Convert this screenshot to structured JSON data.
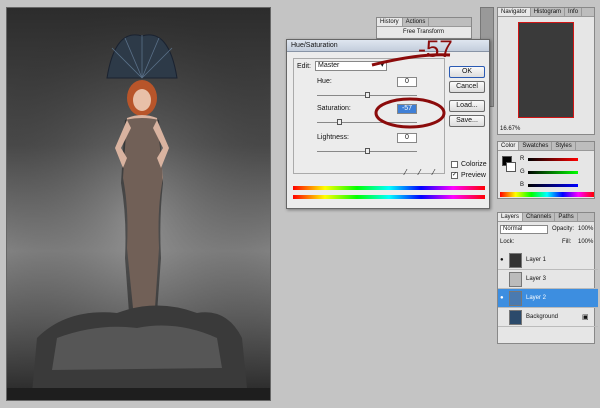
{
  "history_panel": {
    "tabs": [
      "History",
      "Actions"
    ],
    "item": "Free Transform"
  },
  "dialog": {
    "title": "Hue/Saturation",
    "edit_label": "Edit:",
    "edit_value": "Master",
    "hue_label": "Hue:",
    "hue_value": "0",
    "saturation_label": "Saturation:",
    "saturation_value": "-57",
    "lightness_label": "Lightness:",
    "lightness_value": "0",
    "buttons": {
      "ok": "OK",
      "cancel": "Cancel",
      "load": "Load...",
      "save": "Save..."
    },
    "colorize_label": "Colorize",
    "preview_label": "Preview",
    "annotation": "-57"
  },
  "navigator_panel": {
    "tabs": [
      "Navigator",
      "Histogram",
      "Info"
    ],
    "zoom": "16.67%"
  },
  "color_panel": {
    "tabs": [
      "Color",
      "Swatches",
      "Styles"
    ],
    "channels": [
      "R",
      "G",
      "B"
    ],
    "values": [
      "",
      "",
      ""
    ]
  },
  "layers_panel": {
    "tabs": [
      "Layers",
      "Channels",
      "Paths"
    ],
    "blend_mode": "Normal",
    "opacity_label": "Opacity:",
    "opacity_value": "100%",
    "lock_label": "Lock:",
    "fill_label": "Fill:",
    "fill_value": "100%",
    "layers": [
      {
        "name": "Layer 1",
        "visible": true,
        "selected": false
      },
      {
        "name": "Layer 3",
        "visible": false,
        "selected": false
      },
      {
        "name": "Layer 2",
        "visible": true,
        "selected": true
      },
      {
        "name": "Background",
        "visible": false,
        "selected": false
      }
    ]
  },
  "colors": {
    "selection_blue": "#3d8ee0",
    "annotation_red": "#8b0b0b",
    "navigator_frame": "#d01515"
  }
}
